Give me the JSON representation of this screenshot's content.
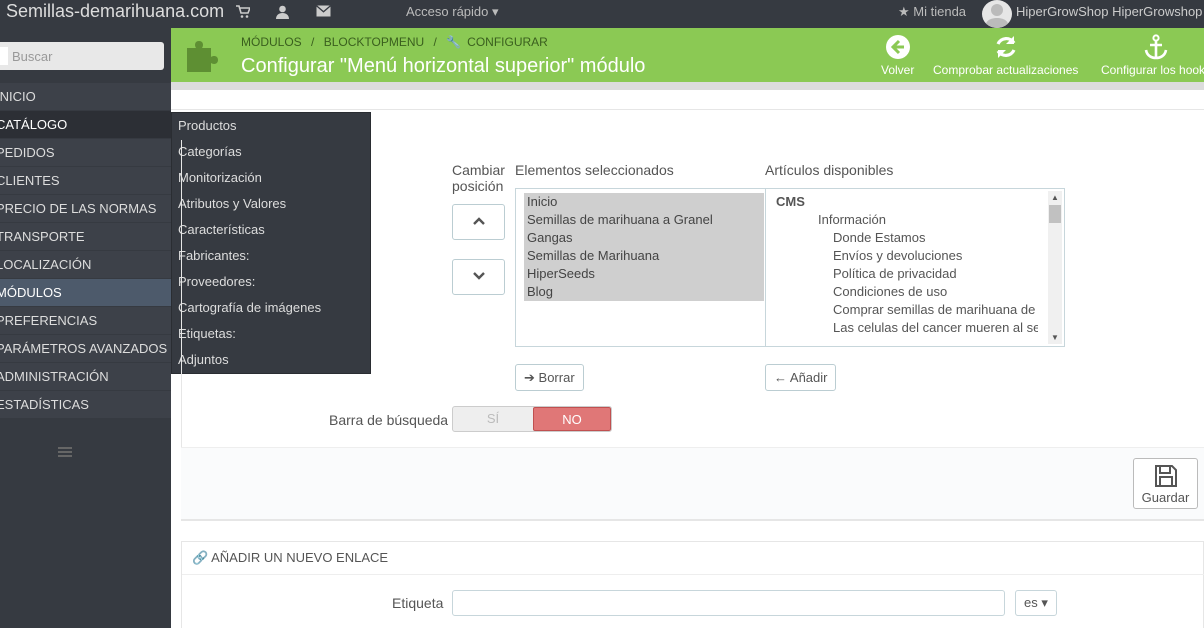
{
  "topbar": {
    "brand": "Semillas-demarihuana.com",
    "quick_access": "Acceso rápido",
    "my_store": "Mi tienda",
    "user": "HiperGrowShop HiperGrowshop",
    "icons": [
      "cart-icon",
      "user-icon",
      "envelope-icon"
    ]
  },
  "sidebar": {
    "search_placeholder": "Buscar",
    "items": [
      {
        "label": "INICIO"
      },
      {
        "label": "CATÁLOGO"
      },
      {
        "label": "PEDIDOS"
      },
      {
        "label": "CLIENTES"
      },
      {
        "label": "PRECIO DE LAS NORMAS"
      },
      {
        "label": "TRANSPORTE"
      },
      {
        "label": "LOCALIZACIÓN"
      },
      {
        "label": "MÓDULOS"
      },
      {
        "label": "PREFERENCIAS"
      },
      {
        "label": "PARÁMETROS AVANZADOS"
      },
      {
        "label": "ADMINISTRACIÓN"
      },
      {
        "label": "ESTADÍSTICAS"
      }
    ]
  },
  "submenu": {
    "items": [
      "Productos",
      "Categorías",
      "Monitorización",
      "Atributos y Valores",
      "Características",
      "Fabricantes:",
      "Proveedores:",
      "Cartografía de imágenes",
      "Etiquetas:",
      "Adjuntos"
    ]
  },
  "header": {
    "breadcrumb": [
      "MÓDULOS",
      "/",
      "BLOCKTOPMENU",
      "/",
      "CONFIGURAR"
    ],
    "title": "Configurar \"Menú horizontal superior\" módulo",
    "tools": {
      "back": "Volver",
      "check_updates": "Comprobar actualizaciones",
      "configure_hooks": "Configurar los hooks"
    }
  },
  "form": {
    "change_position_line1": "Cambiar",
    "change_position_line2": "posición",
    "selected_label": "Elementos seleccionados",
    "available_label": "Artículos disponibles",
    "selected_items": [
      "Inicio",
      "Semillas de marihuana a Granel",
      "Gangas",
      "Semillas de Marihuana",
      "HiperSeeds",
      "Blog"
    ],
    "available_items": [
      {
        "text": "CMS",
        "level": 0
      },
      {
        "text": "Información",
        "level": 1
      },
      {
        "text": "Donde Estamos",
        "level": 2
      },
      {
        "text": "Envíos y devoluciones",
        "level": 2
      },
      {
        "text": "Política de privacidad",
        "level": 2
      },
      {
        "text": "Condiciones de uso",
        "level": 2
      },
      {
        "text": "Comprar semillas de marihuana de fe",
        "level": 2
      },
      {
        "text": "Las celulas del cancer mueren al ser",
        "level": 2
      }
    ],
    "delete_label": "Borrar",
    "add_label": "Añadir",
    "search_bar_label": "Barra de búsqueda",
    "yes_label": "SÍ",
    "no_label": "NO",
    "save_label": "Guardar"
  },
  "new_link": {
    "heading": "AÑADIR UN NUEVO ENLACE",
    "label_field": "Etiqueta",
    "label_value": "",
    "lang": "es"
  },
  "colors": {
    "accent": "#8bc954",
    "sidebar": "#363a41",
    "no_red": "#e07777"
  }
}
